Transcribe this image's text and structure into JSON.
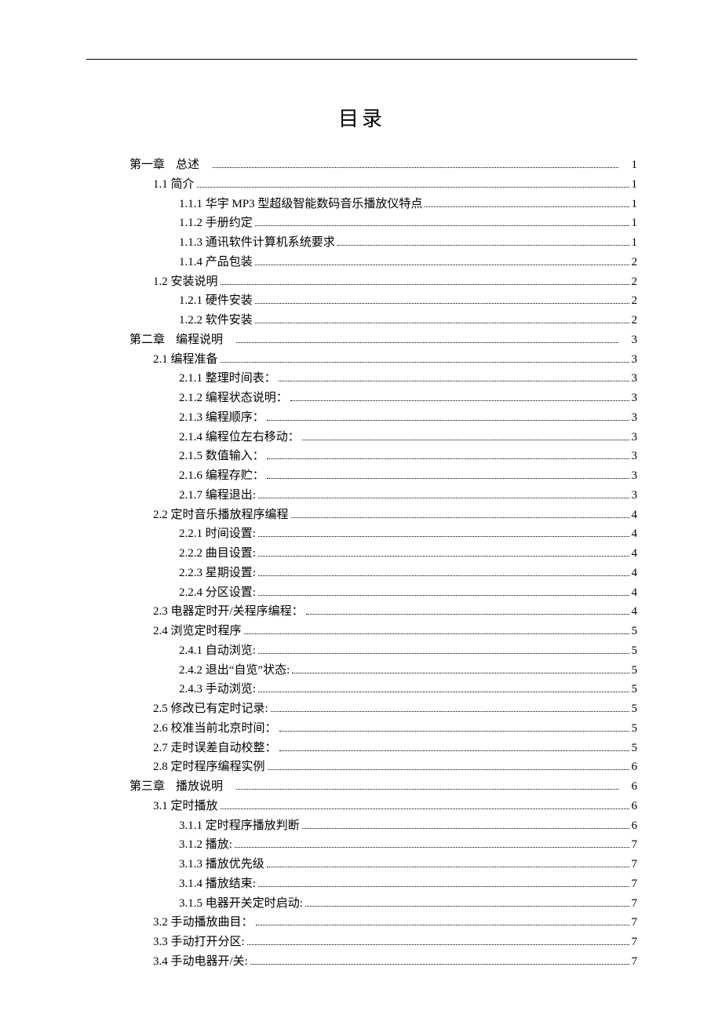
{
  "title": "目录",
  "entries": [
    {
      "level": 1,
      "num": "第一章",
      "title": "总述",
      "page": "1",
      "chapter": true
    },
    {
      "level": 2,
      "num": "1.1",
      "title": "简介",
      "page": "1"
    },
    {
      "level": 3,
      "num": "1.1.1",
      "title": "华宇 MP3 型超级智能数码音乐播放仪特点",
      "page": "1"
    },
    {
      "level": 3,
      "num": "1.1.2",
      "title": "手册约定",
      "page": "1"
    },
    {
      "level": 3,
      "num": "1.1.3",
      "title": "通讯软件计算机系统要求",
      "page": "1"
    },
    {
      "level": 3,
      "num": "1.1.4",
      "title": "产品包装",
      "page": "2"
    },
    {
      "level": 2,
      "num": "1.2",
      "title": "安装说明",
      "page": "2",
      "numGap": true
    },
    {
      "level": 3,
      "num": "1.2.1",
      "title": "硬件安装",
      "page": "2"
    },
    {
      "level": 3,
      "num": "1.2.2",
      "title": "软件安装",
      "page": "2"
    },
    {
      "level": 1,
      "num": "第二章",
      "title": "编程说明",
      "page": "3",
      "chapter": true
    },
    {
      "level": 2,
      "num": "2.1",
      "title": "编程准备",
      "page": "3"
    },
    {
      "level": 3,
      "num": "2.1.1",
      "title": "整理时间表：",
      "page": "3"
    },
    {
      "level": 3,
      "num": "2.1.2",
      "title": "编程状态说明：",
      "page": "3"
    },
    {
      "level": 3,
      "num": "2.1.3",
      "title": "编程顺序：",
      "page": "3"
    },
    {
      "level": 3,
      "num": "2.1.4",
      "title": "编程位左右移动：",
      "page": "3"
    },
    {
      "level": 3,
      "num": "2.1.5",
      "title": "数值输入：",
      "page": "3"
    },
    {
      "level": 3,
      "num": "2.1.6",
      "title": "编程存贮：",
      "page": "3"
    },
    {
      "level": 3,
      "num": "2.1.7",
      "title": "编程退出:",
      "page": "3"
    },
    {
      "level": 2,
      "num": "2.2",
      "title": "定时音乐播放程序编程",
      "page": "4"
    },
    {
      "level": 3,
      "num": "2.2.1",
      "title": "时间设置:",
      "page": "4"
    },
    {
      "level": 3,
      "num": "2.2.2",
      "title": "曲目设置:",
      "page": "4"
    },
    {
      "level": 3,
      "num": "2.2.3",
      "title": "星期设置:",
      "page": "4"
    },
    {
      "level": 3,
      "num": "2.2.4",
      "title": "分区设置:",
      "page": "4"
    },
    {
      "level": 2,
      "num": "2.3",
      "title": "电器定时开/关程序编程：",
      "page": "4"
    },
    {
      "level": 2,
      "num": "2.4",
      "title": "浏览定时程序",
      "page": "5"
    },
    {
      "level": 3,
      "num": "2.4.1",
      "title": "自动浏览:",
      "page": "5"
    },
    {
      "level": 3,
      "num": "2.4.2",
      "title": "退出“自览”状态:",
      "page": "5"
    },
    {
      "level": 3,
      "num": "2.4.3",
      "title": "手动浏览:",
      "page": "5"
    },
    {
      "level": 2,
      "num": "2.5",
      "title": "修改已有定时记录:",
      "page": "5"
    },
    {
      "level": 2,
      "num": "2.6",
      "title": "校准当前北京时间：",
      "page": "5"
    },
    {
      "level": 2,
      "num": "2.7",
      "title": "走时误差自动校整：",
      "page": "5"
    },
    {
      "level": 2,
      "num": "2.8",
      "title": "定时程序编程实例",
      "page": "6"
    },
    {
      "level": 1,
      "num": "第三章",
      "title": "播放说明",
      "page": "6",
      "chapter": true
    },
    {
      "level": 2,
      "num": "3.1",
      "title": "定时播放",
      "page": "6"
    },
    {
      "level": 3,
      "num": "3.1.1",
      "title": "定时程序播放判断",
      "page": "6"
    },
    {
      "level": 3,
      "num": "3.1.2",
      "title": "播放:",
      "page": "7"
    },
    {
      "level": 3,
      "num": "3.1.3",
      "title": "播放优先级",
      "page": "7"
    },
    {
      "level": 3,
      "num": "3.1.4",
      "title": "播放结束:",
      "page": "7"
    },
    {
      "level": 3,
      "num": "3.1.5",
      "title": "电器开关定时启动:",
      "page": "7"
    },
    {
      "level": 2,
      "num": "3.2",
      "title": "手动播放曲目：",
      "page": "7"
    },
    {
      "level": 2,
      "num": "3.3",
      "title": "手动打开分区:",
      "page": "7"
    },
    {
      "level": 2,
      "num": "3.4",
      "title": "手动电器开/关:",
      "page": "7"
    }
  ]
}
